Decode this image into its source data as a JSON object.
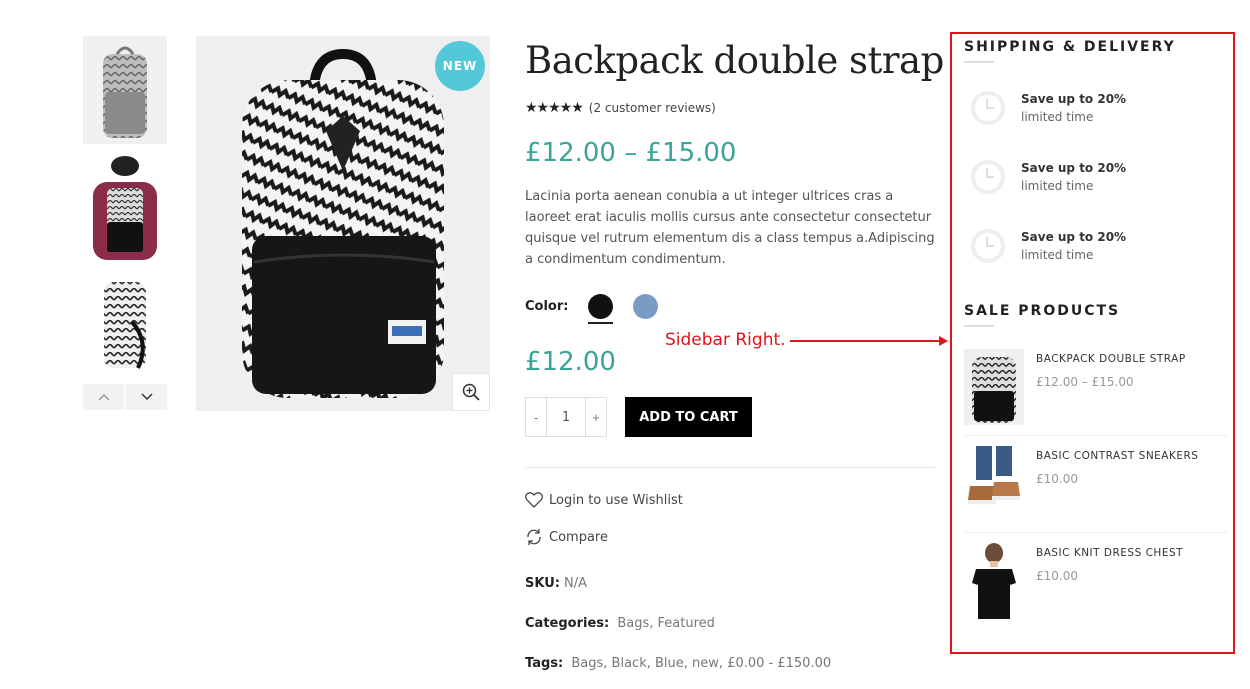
{
  "gallery": {
    "badge": "NEW",
    "thumbnail_count": 3
  },
  "product": {
    "title": "Backpack double strap",
    "rating_stars": 5,
    "reviews_text": "(2 customer reviews)",
    "price_range": "£12.00 – £15.00",
    "description": "Lacinia porta aenean conubia a ut integer ultrices cras a laoreet erat iaculis mollis cursus ante consectetur consectetur quisque vel rutrum elementum dis a class tempus a.Adipiscing a condimentum condimentum.",
    "color_label": "Color:",
    "colors": [
      {
        "name": "black",
        "hex": "#111111",
        "selected": true
      },
      {
        "name": "blue",
        "hex": "#7a9cc4",
        "selected": false
      }
    ],
    "selected_price": "£12.00",
    "quantity": "1",
    "qty_minus": "-",
    "qty_plus": "+",
    "add_to_cart": "ADD TO CART",
    "wishlist_text": "Login to use Wishlist",
    "compare_text": "Compare",
    "sku_label": "SKU:",
    "sku_value": "N/A",
    "categories_label": "Categories:",
    "categories": [
      "Bags",
      "Featured"
    ],
    "tags_label": "Tags:",
    "tags": [
      "Bags",
      "Black",
      "Blue",
      "new",
      "£0.00 - £150.00"
    ]
  },
  "annotation": {
    "text": "Sidebar Right.",
    "color": "#e1141b"
  },
  "sidebar": {
    "shipping_title": "SHIPPING & DELIVERY",
    "shipping_items": [
      {
        "title": "Save up to 20%",
        "subtitle": "limited time"
      },
      {
        "title": "Save up to 20%",
        "subtitle": "limited time"
      },
      {
        "title": "Save up to 20%",
        "subtitle": "limited time"
      }
    ],
    "sale_title": "SALE PRODUCTS",
    "sale_items": [
      {
        "name": "BACKPACK DOUBLE STRAP",
        "price": "£12.00 – £15.00"
      },
      {
        "name": "BASIC CONTRAST SNEAKERS",
        "price": "£10.00"
      },
      {
        "name": "BASIC KNIT DRESS CHEST",
        "price": "£10.00"
      }
    ]
  },
  "colors": {
    "accent_price": "#3aa39a",
    "badge": "#52c8d8",
    "button": "#000000"
  }
}
